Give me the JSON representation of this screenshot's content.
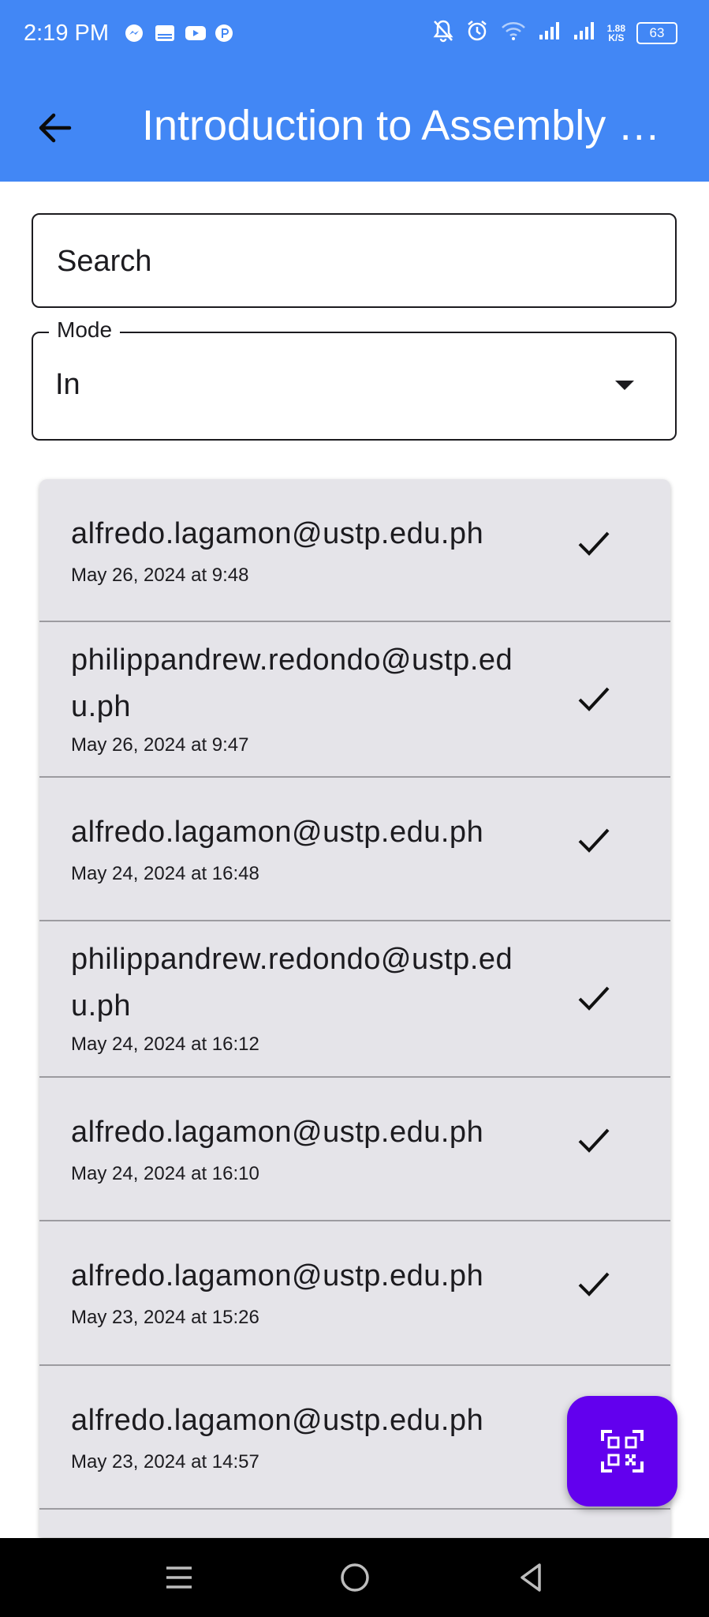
{
  "status_bar": {
    "time": "2:19 PM",
    "speed_value": "1.88",
    "speed_unit": "K/S",
    "battery": "63",
    "left_icons": [
      "messenger-icon",
      "temu-icon",
      "youtube-icon",
      "p-app-icon"
    ],
    "right_icons": [
      "bell-off-icon",
      "alarm-icon",
      "wifi-icon",
      "signal-icon",
      "signal-icon"
    ]
  },
  "app_bar": {
    "title": "Introduction to Assembly …",
    "back_icon": "arrow-left-icon",
    "background": "#4287f5"
  },
  "search": {
    "placeholder": "Search",
    "value": ""
  },
  "mode": {
    "label": "Mode",
    "value": "In"
  },
  "records": [
    {
      "email": "alfredo.lagamon@ustp.edu.ph",
      "date": "May 26, 2024 at 9:48",
      "icon": "check-icon"
    },
    {
      "email": "philippandrew.redondo@ustp.edu.ph",
      "date": "May 26, 2024 at 9:47",
      "icon": "check-icon"
    },
    {
      "email": "alfredo.lagamon@ustp.edu.ph",
      "date": "May 24, 2024 at 16:48",
      "icon": "check-icon"
    },
    {
      "email": "philippandrew.redondo@ustp.edu.ph",
      "date": "May 24, 2024 at 16:12",
      "icon": "check-icon"
    },
    {
      "email": "alfredo.lagamon@ustp.edu.ph",
      "date": "May 24, 2024 at 16:10",
      "icon": "check-icon"
    },
    {
      "email": "alfredo.lagamon@ustp.edu.ph",
      "date": "May 23, 2024 at 15:26",
      "icon": "check-icon"
    },
    {
      "email": "alfredo.lagamon@ustp.edu.ph",
      "date": "May 23, 2024 at 14:57",
      "icon": "check-icon"
    }
  ],
  "fab": {
    "icon": "qr-code-scan-icon",
    "color": "#6200ee"
  },
  "nav_bar": {
    "icons": [
      "recent-apps-icon",
      "home-icon",
      "back-icon"
    ]
  }
}
